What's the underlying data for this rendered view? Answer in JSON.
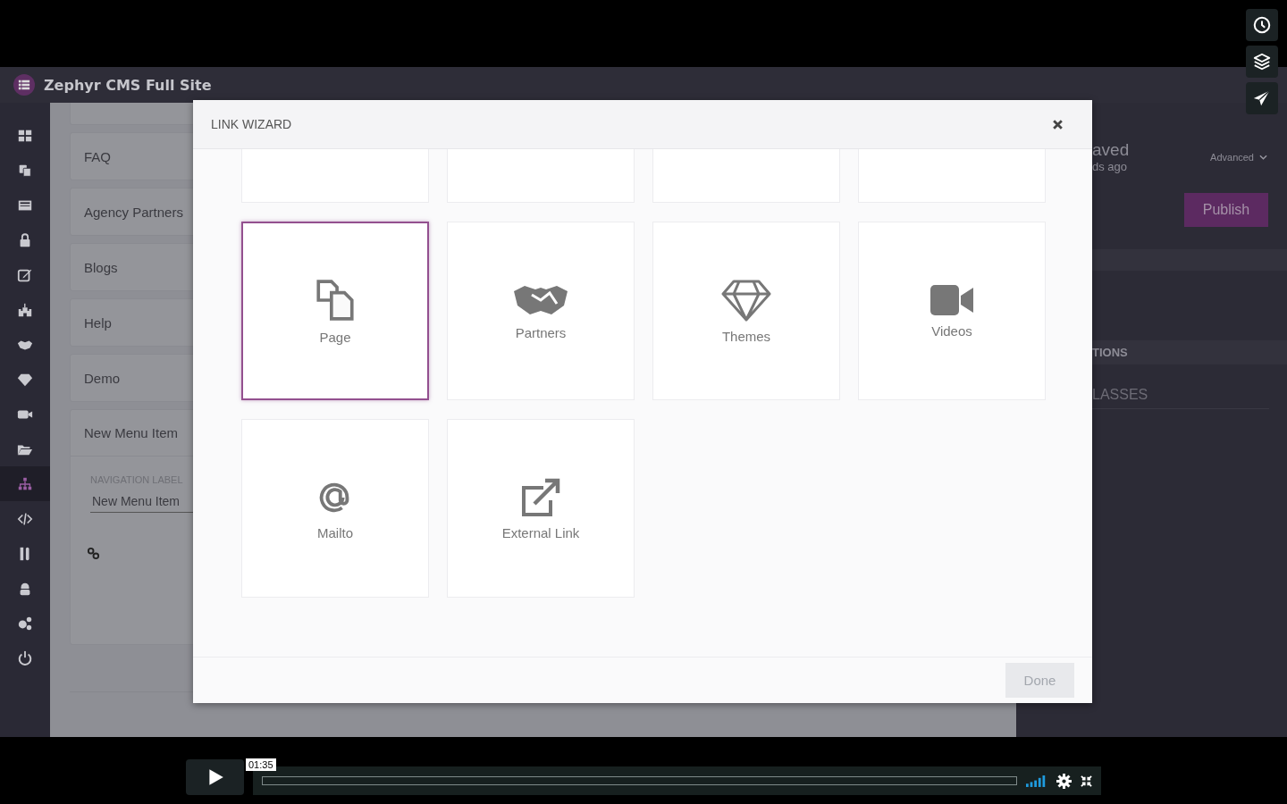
{
  "app": {
    "title": "Zephyr CMS Full Site",
    "rail": [
      {
        "selected": false
      },
      {
        "selected": false
      },
      {
        "selected": false
      },
      {
        "selected": false
      },
      {
        "selected": false
      },
      {
        "selected": false
      },
      {
        "selected": false
      },
      {
        "selected": false
      },
      {
        "selected": false
      },
      {
        "selected": false
      },
      {
        "selected": true
      },
      {
        "selected": false
      },
      {
        "selected": false
      },
      {
        "selected": false
      },
      {
        "selected": false
      },
      {
        "selected": false
      }
    ],
    "menu_items": [
      "FAQ",
      "Agency Partners",
      "Blogs",
      "Help",
      "Demo"
    ],
    "open_item": {
      "title": "New Menu Item",
      "field_label": "NAVIGATION LABEL",
      "value": "New Menu Item"
    },
    "side_panel": {
      "status": "aved",
      "status_time": "ds ago",
      "advanced": "Advanced",
      "publish": "Publish",
      "section": "TIONS",
      "classes": "LASSES"
    }
  },
  "modal": {
    "title": "LINK WIZARD",
    "options": [
      {
        "kind": "page",
        "label": "Page",
        "selected": true
      },
      {
        "kind": "partners",
        "label": "Partners",
        "selected": false
      },
      {
        "kind": "themes",
        "label": "Themes",
        "selected": false
      },
      {
        "kind": "videos",
        "label": "Videos",
        "selected": false
      },
      {
        "kind": "mailto",
        "label": "Mailto",
        "selected": false
      },
      {
        "kind": "external",
        "label": "External Link",
        "selected": false
      }
    ],
    "done": {
      "label": "Done",
      "disabled": true
    }
  },
  "player": {
    "time": "01:35",
    "level": 0
  }
}
